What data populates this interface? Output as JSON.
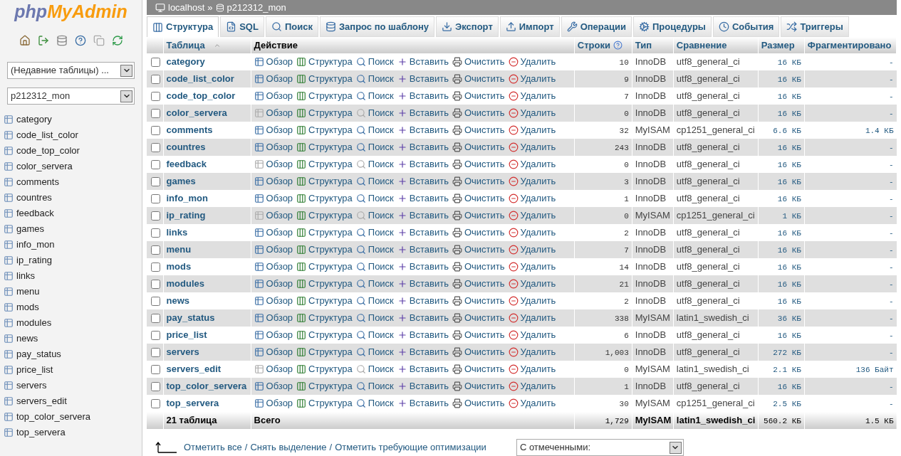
{
  "logo": {
    "part1": "php",
    "part2": "MyAdmin"
  },
  "sidebar": {
    "recent_select": "(Недавние таблицы) ...",
    "db_select": "p212312_mon",
    "items": [
      "category",
      "code_list_color",
      "code_top_color",
      "color_servera",
      "comments",
      "countres",
      "feedback",
      "games",
      "info_mon",
      "ip_rating",
      "links",
      "menu",
      "mods",
      "modules",
      "news",
      "pay_status",
      "price_list",
      "servers",
      "servers_edit",
      "top_color_servera",
      "top_servera"
    ]
  },
  "breadcrumb": {
    "server": "localhost",
    "separator": "»",
    "database": "p212312_mon"
  },
  "tabs": [
    {
      "label": "Структура",
      "kind": "structure",
      "selected": true
    },
    {
      "label": "SQL",
      "kind": "sql",
      "selected": false
    },
    {
      "label": "Поиск",
      "kind": "search",
      "selected": false
    },
    {
      "label": "Запрос по шаблону",
      "kind": "query",
      "selected": false
    },
    {
      "label": "Экспорт",
      "kind": "export",
      "selected": false
    },
    {
      "label": "Импорт",
      "kind": "import",
      "selected": false
    },
    {
      "label": "Операции",
      "kind": "operations",
      "selected": false
    },
    {
      "label": "Процедуры",
      "kind": "routines",
      "selected": false
    },
    {
      "label": "События",
      "kind": "events",
      "selected": false
    },
    {
      "label": "Триггеры",
      "kind": "triggers",
      "selected": false
    }
  ],
  "table": {
    "columns": [
      "Таблица",
      "Действие",
      "Строки",
      "Тип",
      "Сравнение",
      "Размер",
      "Фрагментировано"
    ],
    "rows": [
      {
        "name": "category",
        "actions": [
          "Обзор",
          "Структура",
          "Поиск",
          "Вставить",
          "Очистить",
          "Удалить"
        ],
        "empty": false,
        "checked": false,
        "rows": "10",
        "type": "InnoDB",
        "collation": "utf8_general_ci",
        "size": "16 КБ",
        "overhead": "-"
      },
      {
        "name": "code_list_color",
        "actions": [
          "Обзор",
          "Структура",
          "Поиск",
          "Вставить",
          "Очистить",
          "Удалить"
        ],
        "empty": false,
        "checked": false,
        "rows": "9",
        "type": "InnoDB",
        "collation": "utf8_general_ci",
        "size": "16 КБ",
        "overhead": "-"
      },
      {
        "name": "code_top_color",
        "actions": [
          "Обзор",
          "Структура",
          "Поиск",
          "Вставить",
          "Очистить",
          "Удалить"
        ],
        "empty": false,
        "checked": false,
        "rows": "7",
        "type": "InnoDB",
        "collation": "utf8_general_ci",
        "size": "16 КБ",
        "overhead": "-"
      },
      {
        "name": "color_servera",
        "actions": [
          "Обзор",
          "Структура",
          "Поиск",
          "Вставить",
          "Очистить",
          "Удалить"
        ],
        "empty": true,
        "checked": false,
        "rows": "0",
        "type": "InnoDB",
        "collation": "utf8_general_ci",
        "size": "16 КБ",
        "overhead": "-"
      },
      {
        "name": "comments",
        "actions": [
          "Обзор",
          "Структура",
          "Поиск",
          "Вставить",
          "Очистить",
          "Удалить"
        ],
        "empty": false,
        "checked": false,
        "rows": "32",
        "type": "MyISAM",
        "collation": "cp1251_general_ci",
        "size": "6.6 КБ",
        "overhead": "1.4 КБ"
      },
      {
        "name": "countres",
        "actions": [
          "Обзор",
          "Структура",
          "Поиск",
          "Вставить",
          "Очистить",
          "Удалить"
        ],
        "empty": false,
        "checked": false,
        "rows": "243",
        "type": "InnoDB",
        "collation": "utf8_general_ci",
        "size": "16 КБ",
        "overhead": "-"
      },
      {
        "name": "feedback",
        "actions": [
          "Обзор",
          "Структура",
          "Поиск",
          "Вставить",
          "Очистить",
          "Удалить"
        ],
        "empty": true,
        "checked": false,
        "rows": "0",
        "type": "InnoDB",
        "collation": "utf8_general_ci",
        "size": "16 КБ",
        "overhead": "-"
      },
      {
        "name": "games",
        "actions": [
          "Обзор",
          "Структура",
          "Поиск",
          "Вставить",
          "Очистить",
          "Удалить"
        ],
        "empty": false,
        "checked": false,
        "rows": "3",
        "type": "InnoDB",
        "collation": "utf8_general_ci",
        "size": "16 КБ",
        "overhead": "-"
      },
      {
        "name": "info_mon",
        "actions": [
          "Обзор",
          "Структура",
          "Поиск",
          "Вставить",
          "Очистить",
          "Удалить"
        ],
        "empty": false,
        "checked": false,
        "rows": "1",
        "type": "InnoDB",
        "collation": "utf8_general_ci",
        "size": "16 КБ",
        "overhead": "-"
      },
      {
        "name": "ip_rating",
        "actions": [
          "Обзор",
          "Структура",
          "Поиск",
          "Вставить",
          "Очистить",
          "Удалить"
        ],
        "empty": true,
        "checked": false,
        "rows": "0",
        "type": "MyISAM",
        "collation": "cp1251_general_ci",
        "size": "1 КБ",
        "overhead": "-"
      },
      {
        "name": "links",
        "actions": [
          "Обзор",
          "Структура",
          "Поиск",
          "Вставить",
          "Очистить",
          "Удалить"
        ],
        "empty": false,
        "checked": false,
        "rows": "2",
        "type": "InnoDB",
        "collation": "utf8_general_ci",
        "size": "16 КБ",
        "overhead": "-"
      },
      {
        "name": "menu",
        "actions": [
          "Обзор",
          "Структура",
          "Поиск",
          "Вставить",
          "Очистить",
          "Удалить"
        ],
        "empty": false,
        "checked": false,
        "rows": "7",
        "type": "InnoDB",
        "collation": "utf8_general_ci",
        "size": "16 КБ",
        "overhead": "-"
      },
      {
        "name": "mods",
        "actions": [
          "Обзор",
          "Структура",
          "Поиск",
          "Вставить",
          "Очистить",
          "Удалить"
        ],
        "empty": false,
        "checked": false,
        "rows": "14",
        "type": "InnoDB",
        "collation": "utf8_general_ci",
        "size": "16 КБ",
        "overhead": "-"
      },
      {
        "name": "modules",
        "actions": [
          "Обзор",
          "Структура",
          "Поиск",
          "Вставить",
          "Очистить",
          "Удалить"
        ],
        "empty": false,
        "checked": false,
        "rows": "21",
        "type": "InnoDB",
        "collation": "utf8_general_ci",
        "size": "16 КБ",
        "overhead": "-"
      },
      {
        "name": "news",
        "actions": [
          "Обзор",
          "Структура",
          "Поиск",
          "Вставить",
          "Очистить",
          "Удалить"
        ],
        "empty": false,
        "checked": false,
        "rows": "2",
        "type": "InnoDB",
        "collation": "utf8_general_ci",
        "size": "16 КБ",
        "overhead": "-"
      },
      {
        "name": "pay_status",
        "actions": [
          "Обзор",
          "Структура",
          "Поиск",
          "Вставить",
          "Очистить",
          "Удалить"
        ],
        "empty": false,
        "checked": false,
        "rows": "338",
        "type": "MyISAM",
        "collation": "latin1_swedish_ci",
        "size": "36 КБ",
        "overhead": "-"
      },
      {
        "name": "price_list",
        "actions": [
          "Обзор",
          "Структура",
          "Поиск",
          "Вставить",
          "Очистить",
          "Удалить"
        ],
        "empty": false,
        "checked": false,
        "rows": "6",
        "type": "InnoDB",
        "collation": "utf8_general_ci",
        "size": "16 КБ",
        "overhead": "-"
      },
      {
        "name": "servers",
        "actions": [
          "Обзор",
          "Структура",
          "Поиск",
          "Вставить",
          "Очистить",
          "Удалить"
        ],
        "empty": false,
        "checked": false,
        "rows": "1,003",
        "type": "InnoDB",
        "collation": "utf8_general_ci",
        "size": "272 КБ",
        "overhead": "-"
      },
      {
        "name": "servers_edit",
        "actions": [
          "Обзор",
          "Структура",
          "Поиск",
          "Вставить",
          "Очистить",
          "Удалить"
        ],
        "empty": true,
        "checked": false,
        "rows": "0",
        "type": "MyISAM",
        "collation": "latin1_swedish_ci",
        "size": "2.1 КБ",
        "overhead": "136 Байт"
      },
      {
        "name": "top_color_servera",
        "actions": [
          "Обзор",
          "Структура",
          "Поиск",
          "Вставить",
          "Очистить",
          "Удалить"
        ],
        "empty": false,
        "checked": false,
        "rows": "1",
        "type": "InnoDB",
        "collation": "utf8_general_ci",
        "size": "16 КБ",
        "overhead": "-"
      },
      {
        "name": "top_servera",
        "actions": [
          "Обзор",
          "Структура",
          "Поиск",
          "Вставить",
          "Очистить",
          "Удалить"
        ],
        "empty": false,
        "checked": false,
        "rows": "30",
        "type": "MyISAM",
        "collation": "cp1251_general_ci",
        "size": "2.5 КБ",
        "overhead": "-"
      }
    ],
    "footer": {
      "name": "21 таблица",
      "action": "Всего",
      "rows": "1,729",
      "type": "MyISAM",
      "collation": "latin1_swedish_ci",
      "size": "560.2 КБ",
      "overhead": "1.5 КБ"
    }
  },
  "bulk": {
    "links": [
      "Отметить все",
      "Снять выделение",
      "Отметить требующие оптимизации"
    ],
    "separator": "/",
    "select": "С отмеченными:"
  }
}
